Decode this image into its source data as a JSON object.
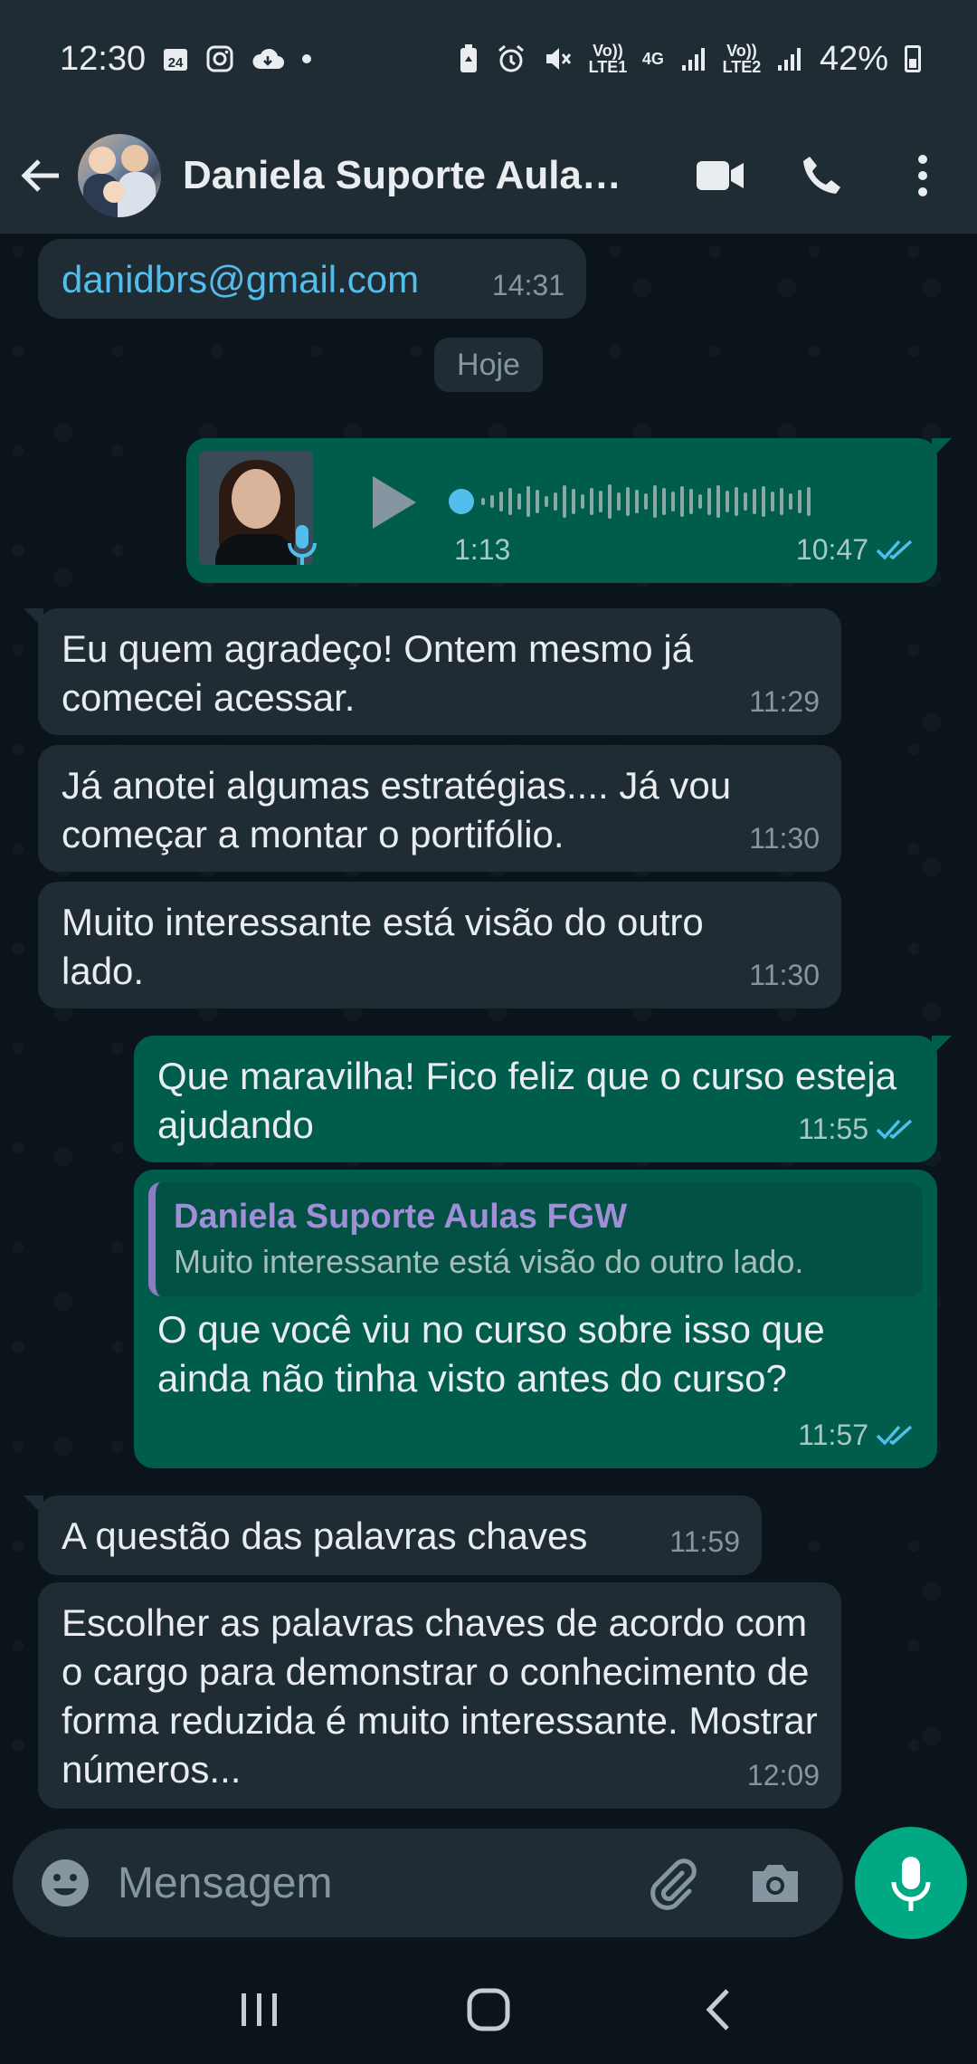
{
  "status_bar": {
    "time": "12:30",
    "calendar_day": "24",
    "lte1_label": "Vo)) LTE1",
    "net_label": "4G",
    "lte2_label": "Vo)) LTE2",
    "battery": "42%"
  },
  "header": {
    "contact_name": "Daniela Suporte Aulas..."
  },
  "chat": {
    "email_message": {
      "text": "danidbrs@gmail.com",
      "time": "14:31"
    },
    "date_separator": "Hoje",
    "voice_message": {
      "duration": "1:13",
      "time": "10:47"
    },
    "messages": [
      {
        "text": "Eu quem agradeço! Ontem mesmo já comecei acessar.",
        "time": "11:29",
        "direction": "in"
      },
      {
        "text": "Já anotei algumas estratégias.... Já vou começar a montar o portifólio.",
        "time": "11:30",
        "direction": "in"
      },
      {
        "text": "Muito interessante está visão do outro lado.",
        "time": "11:30",
        "direction": "in"
      },
      {
        "text": "Que maravilha! Fico feliz que o curso esteja ajudando",
        "time": "11:55",
        "direction": "out"
      },
      {
        "text": "O que você viu no curso sobre isso que ainda não tinha visto antes do curso?",
        "time": "11:57",
        "direction": "out"
      },
      {
        "text": "A questão das palavras chaves",
        "time": "11:59",
        "direction": "in"
      },
      {
        "text": "Escolher as palavras chaves de acordo com o cargo para demonstrar o conhecimento de forma reduzida é muito interessante. Mostrar números...",
        "time": "12:09",
        "direction": "in"
      }
    ],
    "reply_quote": {
      "author": "Daniela Suporte Aulas FGW",
      "text": "Muito interessante está visão do outro lado."
    }
  },
  "composer": {
    "placeholder": "Mensagem"
  },
  "colors": {
    "incoming_bubble": "#1f2c34",
    "outgoing_bubble": "#005c4b",
    "accent": "#00a884",
    "read_ticks": "#53bdeb",
    "link": "#53bdeb"
  }
}
